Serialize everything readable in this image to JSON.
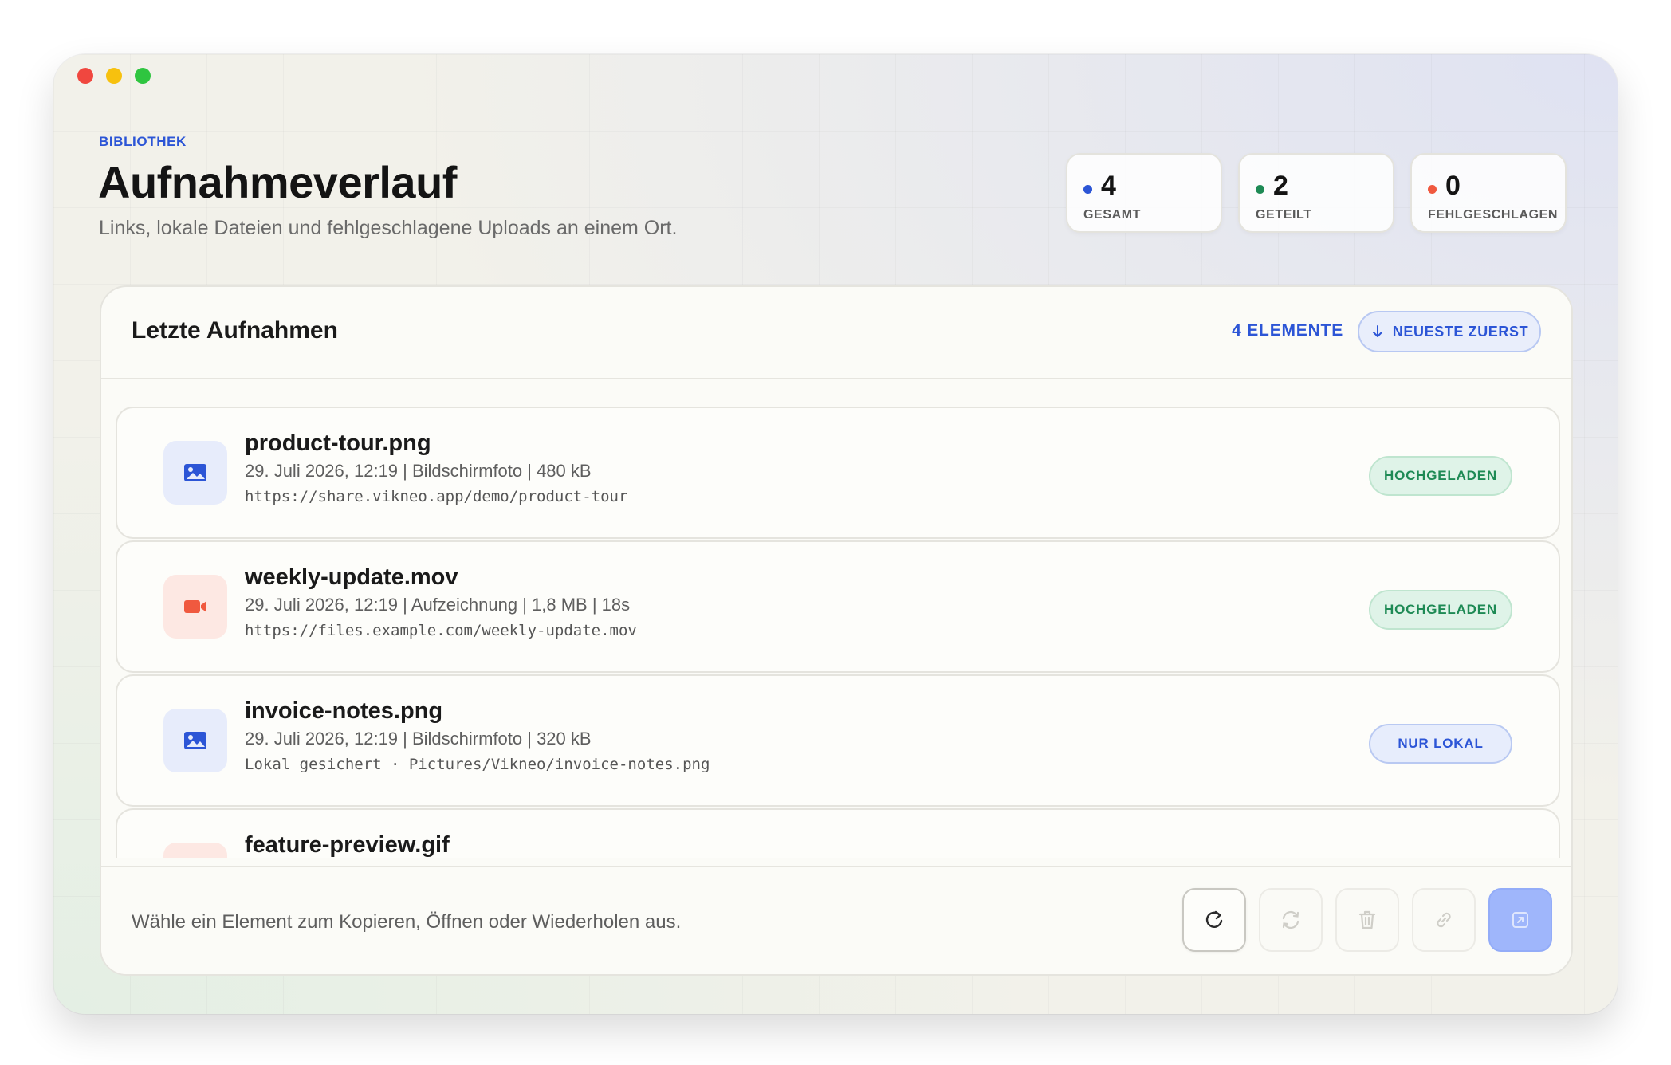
{
  "header": {
    "eyebrow": "BIBLIOTHEK",
    "title": "Aufnahmeverlauf",
    "subtitle": "Links, lokale Dateien und fehlgeschlagene Uploads an einem Ort."
  },
  "stats": [
    {
      "value": "4",
      "label": "GESAMT",
      "color": "#2c55d6"
    },
    {
      "value": "2",
      "label": "GETEILT",
      "color": "#1e8a55"
    },
    {
      "value": "0",
      "label": "FEHLGESCHLAGEN",
      "color": "#f0593f"
    }
  ],
  "panel": {
    "title": "Letzte Aufnahmen",
    "count": "4 ELEMENTE",
    "sort_label": "NEUESTE ZUERST"
  },
  "items": [
    {
      "name": "product-tour.png",
      "meta": "29. Juli 2026, 12:19  |  Bildschirmfoto  |  480 kB",
      "path": "https://share.vikneo.app/demo/product-tour",
      "status": "HOCHGELADEN",
      "icon": "image-icon"
    },
    {
      "name": "weekly-update.mov",
      "meta": "29. Juli 2026, 12:19  |  Aufzeichnung  |  1,8 MB  |  18s",
      "path": "https://files.example.com/weekly-update.mov",
      "status": "HOCHGELADEN",
      "icon": "video-icon"
    },
    {
      "name": "invoice-notes.png",
      "meta": "29. Juli 2026, 12:19  |  Bildschirmfoto  |  320 kB",
      "path": "Lokal gesichert · Pictures/Vikneo/invoice-notes.png",
      "status": "NUR LOKAL",
      "icon": "image-icon"
    },
    {
      "name": "feature-preview.gif",
      "meta": "",
      "path": "",
      "status": "",
      "icon": "gif-icon"
    }
  ],
  "footer": {
    "hint": "Wähle ein Element zum Kopieren, Öffnen oder Wiederholen aus."
  },
  "colors": {
    "accent": "#2c55d6",
    "success": "#1e8a55",
    "video": "#f0593f",
    "primary_button": "#9fb6fb"
  }
}
